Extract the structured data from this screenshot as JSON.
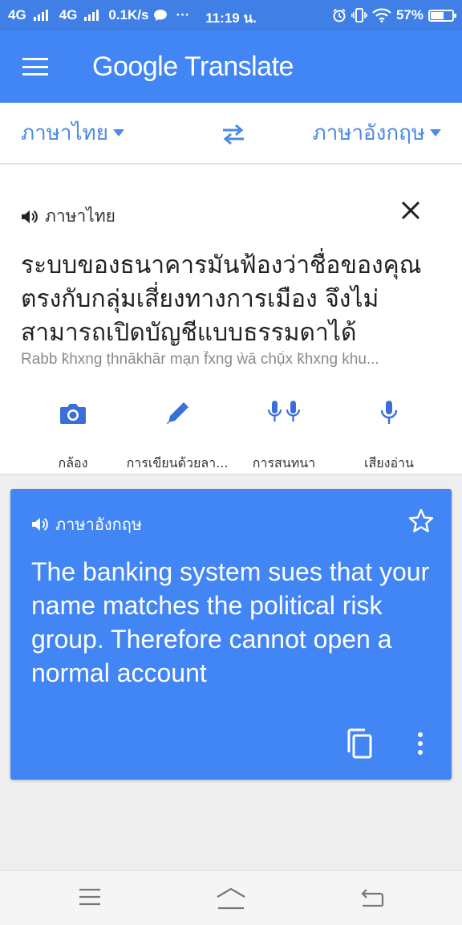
{
  "status_bar": {
    "network1": "4G",
    "network2": "4G",
    "speed": "0.1K/s",
    "dots": "···",
    "time": "11:19 น.",
    "battery": "57%",
    "battery_level": 0.57
  },
  "app_bar": {
    "title_google": "Google",
    "title_translate": "Translate"
  },
  "language_bar": {
    "source": "ภาษาไทย",
    "target": "ภาษาอังกฤษ"
  },
  "input": {
    "label": "ภาษาไทย",
    "text": "ระบบของธนาคารมันฟ้องว่าชื่อของคุณตรงกับกลุ่มเสี่ยงทางการเมือง จึงไม่สามารถเปิดบัญชีแบบธรรมดาได้",
    "romanization": "Rabb k̄hxng ṭhnākhār mạn f̂xng ẁā chụ̄̀x k̄hxng khu..."
  },
  "tools": {
    "camera": "กล้อง",
    "handwriting": "การเขียนด้วยลา...",
    "conversation": "การสนทนา",
    "voice": "เสียงอ่าน"
  },
  "result": {
    "label": "ภาษาอังกฤษ",
    "text": "The banking system sues that your name matches the political risk group.  Therefore cannot open a normal account"
  },
  "colors": {
    "primary": "#4285f4",
    "status": "#3f7fe6",
    "accent_text": "#4a8ae8",
    "icon_blue": "#3b6fd8"
  }
}
